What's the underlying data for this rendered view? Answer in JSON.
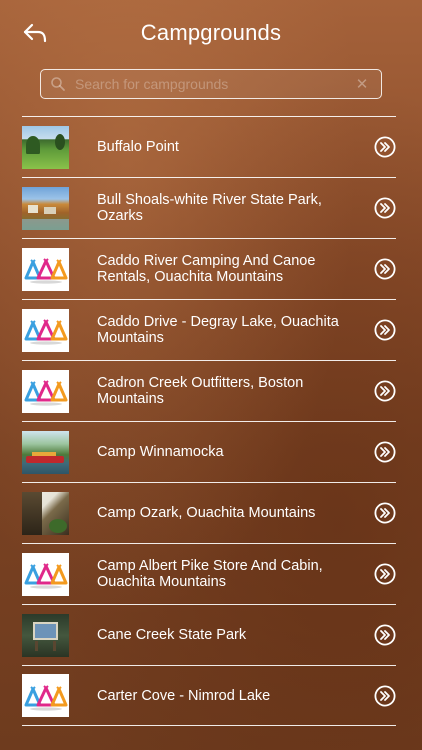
{
  "header": {
    "title": "Campgrounds",
    "back_icon": "back-arrow-icon"
  },
  "search": {
    "placeholder": "Search for campgrounds",
    "value": ""
  },
  "campgrounds": [
    {
      "name": "Buffalo Point",
      "thumb": "photo-golf-course"
    },
    {
      "name": "Bull Shoals-white River State Park, Ozarks",
      "thumb": "photo-lake-town"
    },
    {
      "name": "Caddo River Camping And Canoe Rentals, Ouachita Mountains",
      "thumb": "tent-logo"
    },
    {
      "name": "Caddo Drive - Degray Lake, Ouachita Mountains",
      "thumb": "tent-logo"
    },
    {
      "name": "Cadron Creek Outfitters, Boston Mountains",
      "thumb": "tent-logo"
    },
    {
      "name": "Camp Winnamocka",
      "thumb": "photo-boats"
    },
    {
      "name": "Camp Ozark, Ouachita Mountains",
      "thumb": "photo-forest-cliff"
    },
    {
      "name": "Camp Albert Pike Store And Cabin, Ouachita Mountains",
      "thumb": "tent-logo"
    },
    {
      "name": "Cane Creek State Park",
      "thumb": "photo-sign"
    },
    {
      "name": "Carter Cove - Nimrod Lake",
      "thumb": "tent-logo"
    }
  ],
  "colors": {
    "tent_blue": "#3aa0e0",
    "tent_pink": "#e0288a",
    "tent_orange": "#f39a1f"
  }
}
